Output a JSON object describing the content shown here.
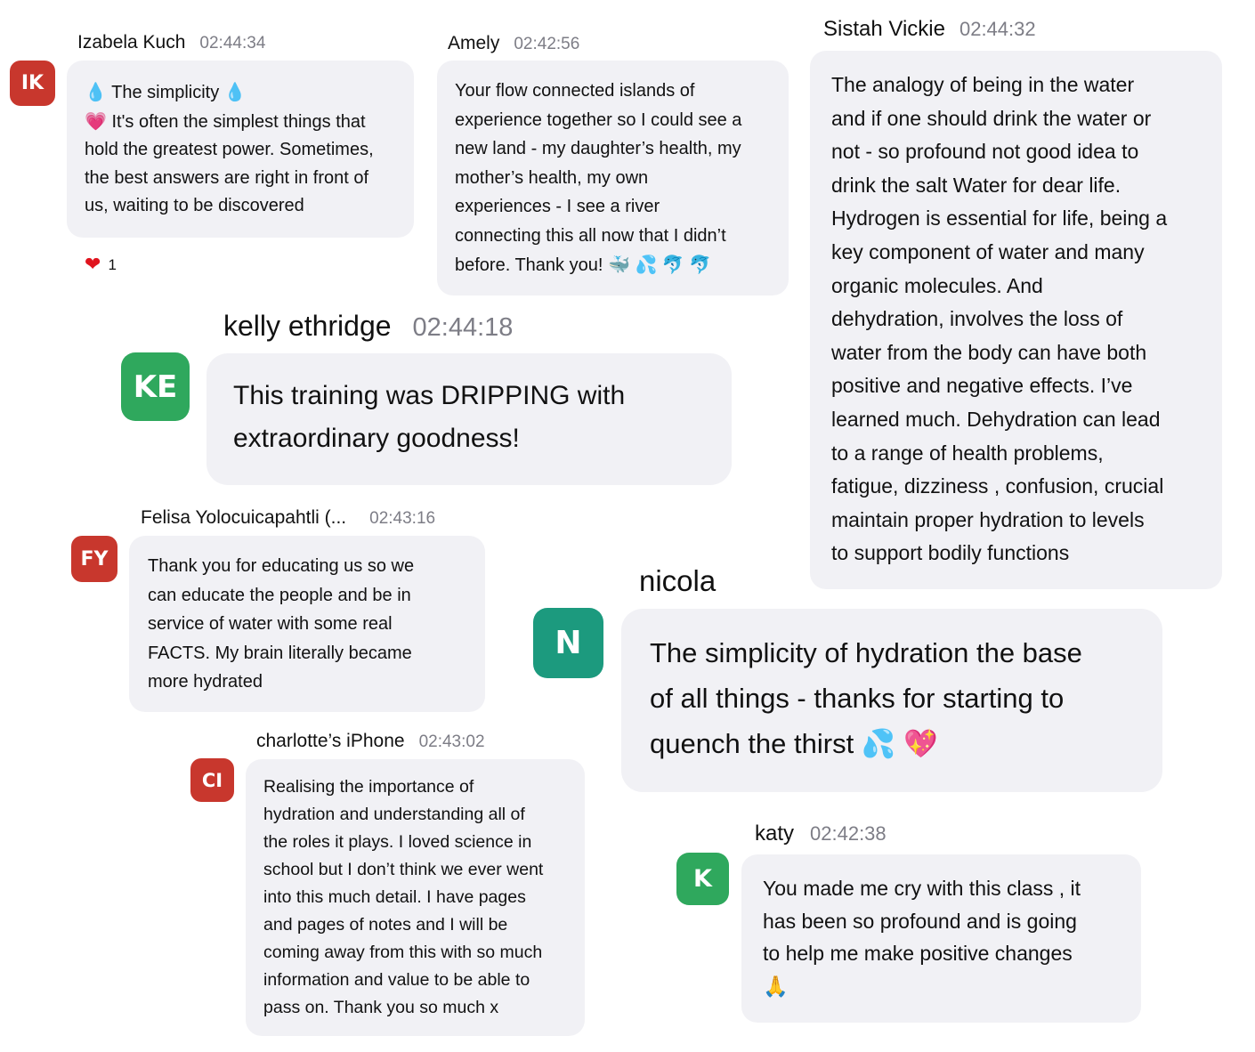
{
  "colors": {
    "avatar_red": "#c8372d",
    "avatar_green": "#2fa85d",
    "avatar_teal": "#1c9a7e",
    "bubble_bg": "#f1f1f5",
    "time_gray": "#7d7d86"
  },
  "messages": {
    "izabela": {
      "initials": "IK",
      "name": "Izabela Kuch",
      "time": "02:44:34",
      "line1": "The simplicity",
      "line2": "It's often the simplest things that",
      "text_rest": "hold the greatest power. Sometimes,\nthe best answers are right in front of\nus, waiting to be discovered",
      "reaction_count": "1"
    },
    "amely": {
      "name": "Amely",
      "time": "02:42:56",
      "text": "Your flow connected islands of\nexperience together so I could see a\nnew land - my daughter’s health, my\nmother’s health, my own\nexperiences - I see a river\nconnecting this all now that I didn’t",
      "last_line": "before. Thank you!"
    },
    "vickie": {
      "name": "Sistah Vickie",
      "time": "02:44:32",
      "text": "The analogy of being in the water\nand if one should drink the water or\nnot - so profound not good idea to\ndrink the salt Water for dear life.\nHydrogen is essential for life, being a\nkey component of water and many\norganic molecules.  And\ndehydration, involves the loss of\nwater from the body can have both\npositive and negative effects.  I’ve\nlearned much.  Dehydration can lead\nto a range of health problems,\nfatigue, dizziness , confusion, crucial\nmaintain proper hydration to levels\nto support bodily functions"
    },
    "kelly": {
      "initials": "KE",
      "name": "kelly ethridge",
      "time": "02:44:18",
      "text": "This training was DRIPPING with\nextraordinary goodness!"
    },
    "felisa": {
      "initials": "FY",
      "name": "Felisa Yolocuicapahtli (...",
      "time": "02:43:16",
      "text": "Thank you for educating us so we\ncan educate the people and be in\nservice of water with some real\nFACTS. My brain literally became\nmore hydrated"
    },
    "nicola": {
      "initials": "N",
      "name": "nicola",
      "text": "The simplicity of hydration the base\nof all things - thanks for starting to",
      "last_line": "quench the thirst"
    },
    "charlotte": {
      "initials": "CI",
      "name": "charlotte’s iPhone",
      "time": "02:43:02",
      "text": "Realising the importance of\nhydration and understanding all of\nthe roles it plays. I loved science in\nschool but I don’t think we ever went\ninto this much detail. I have pages\nand pages of notes and I will be\ncoming away from this with so much\ninformation and value to be able to\npass on. Thank you so much x"
    },
    "katy": {
      "initials": "K",
      "name": "katy",
      "time": "02:42:38",
      "text": "You made me cry with this class , it\nhas been so profound and is going\nto help me make positive changes"
    }
  }
}
